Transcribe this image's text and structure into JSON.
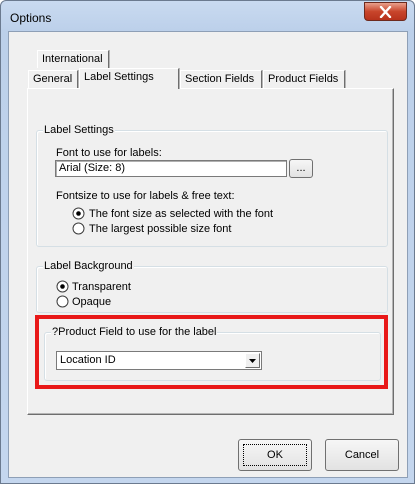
{
  "window": {
    "title": "Options"
  },
  "tabs": {
    "row1": [
      {
        "label": "International"
      }
    ],
    "row2": [
      {
        "label": "General"
      },
      {
        "label": "Label Settings",
        "active": true
      },
      {
        "label": "Section Fields"
      },
      {
        "label": "Product Fields"
      }
    ]
  },
  "label_settings": {
    "group_title": "Label Settings",
    "font_label": "Font to use for labels:",
    "font_value": "Arial (Size: 8)",
    "browse_label": "...",
    "fontsize_label": "Fontsize to use for labels & free text:",
    "fontsize_options": [
      {
        "label": "The font size as selected with the font",
        "checked": true
      },
      {
        "label": "The largest possible size font",
        "checked": false
      }
    ]
  },
  "label_background": {
    "group_title": "Label Background",
    "options": [
      {
        "label": "Transparent",
        "checked": true
      },
      {
        "label": "Opaque",
        "checked": false
      }
    ]
  },
  "product_field": {
    "group_title": "?Product Field to use for the label",
    "selected": "Location ID"
  },
  "buttons": {
    "ok": "OK",
    "cancel": "Cancel"
  },
  "colors": {
    "highlight_border": "#e81818",
    "close_button": "#c8452b",
    "title_bar": "#bcd0ea",
    "dialog_background": "#f0f0f0"
  },
  "icons": {
    "close": "close-x-icon",
    "dropdown": "chevron-down-icon",
    "radio_selected": "radio-selected-icon",
    "radio_unselected": "radio-unselected-icon"
  }
}
